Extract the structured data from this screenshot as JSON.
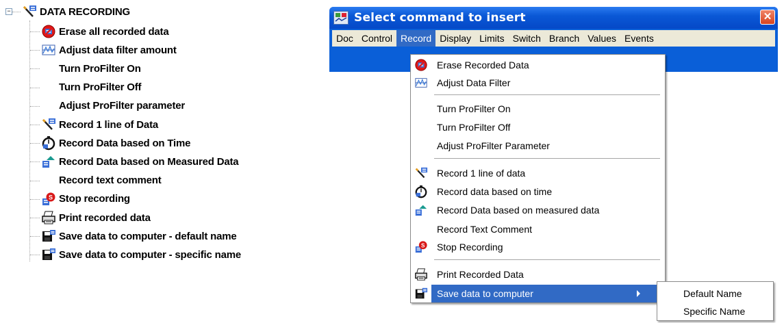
{
  "tree": {
    "root_toggle": "−",
    "root_label": "DATA RECORDING",
    "items": [
      {
        "label": "Erase all recorded data",
        "icon": "erase-icon"
      },
      {
        "label": "Adjust data filter amount",
        "icon": "filter-chart-icon"
      },
      {
        "label": "Turn ProFilter On",
        "icon": ""
      },
      {
        "label": "Turn ProFilter Off",
        "icon": ""
      },
      {
        "label": "Adjust ProFilter parameter",
        "icon": ""
      },
      {
        "label": "Record 1 line of Data",
        "icon": "record-line-icon"
      },
      {
        "label": "Record Data based on Time",
        "icon": "stopwatch-icon"
      },
      {
        "label": "Record Data based on Measured Data",
        "icon": "measured-data-icon"
      },
      {
        "label": "Record text comment",
        "icon": ""
      },
      {
        "label": "Stop recording",
        "icon": "stop-recording-icon"
      },
      {
        "label": "Print recorded data",
        "icon": "printer-icon"
      },
      {
        "label": "Save data to computer - default name",
        "icon": "save-disk-icon"
      },
      {
        "label": "Save data to computer - specific name",
        "icon": "save-disk-icon"
      }
    ]
  },
  "dialog": {
    "title": "Select command to insert",
    "close_glyph": "✕",
    "menu": [
      "Doc",
      "Control",
      "Record",
      "Display",
      "Limits",
      "Switch",
      "Branch",
      "Values",
      "Events"
    ],
    "active_menu": "Record"
  },
  "dropdown": {
    "items": [
      {
        "label": "Erase Recorded Data",
        "icon": "erase-icon"
      },
      {
        "label": "Adjust Data Filter",
        "icon": "filter-chart-icon"
      },
      {
        "label": "Turn ProFilter On",
        "icon": ""
      },
      {
        "label": "Turn ProFilter Off",
        "icon": ""
      },
      {
        "label": "Adjust ProFilter Parameter",
        "icon": ""
      },
      {
        "label": "Record 1 line of data",
        "icon": "record-line-icon"
      },
      {
        "label": "Record data based on time",
        "icon": "stopwatch-icon"
      },
      {
        "label": "Record Data based on measured data",
        "icon": "measured-data-icon"
      },
      {
        "label": "Record Text Comment",
        "icon": ""
      },
      {
        "label": "Stop Recording",
        "icon": "stop-recording-icon"
      },
      {
        "label": "Print Recorded Data",
        "icon": "printer-icon"
      },
      {
        "label": "Save data to computer",
        "icon": "save-disk-icon",
        "highlighted": true
      }
    ]
  },
  "submenu": {
    "items": [
      "Default Name",
      "Specific Name"
    ]
  },
  "colors": {
    "title_blue": "#0a5fd8",
    "menu_highlight": "#316ac5",
    "menubar_bg": "#ece9d8"
  }
}
